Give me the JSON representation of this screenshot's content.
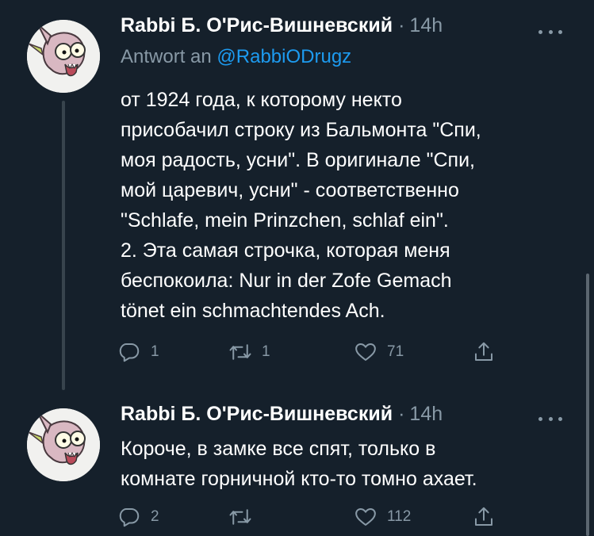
{
  "tweets": [
    {
      "author": "Rabbi Б. О'Рис-Вишневский",
      "separator": "·",
      "time": "14h",
      "reply_prefix": "Antwort an",
      "reply_handle": "@RabbiODrugz",
      "lines": [
        "от 1924 года, к которому некто",
        "присобачил строку из Бальмонта \"Спи,",
        "моя радость, усни\". В оригинале \"Спи,",
        "мой царевич, усни\" - соответственно",
        "\"Schlafe, mein Prinzchen, schlaf ein\".",
        "2. Эта самая строчка, которая меня",
        "беспокоила: Nur in der Zofe Gemach",
        "tönet ein schmachtendes Ach."
      ],
      "replies": "1",
      "retweets": "1",
      "likes": "71"
    },
    {
      "author": "Rabbi Б. О'Рис-Вишневский",
      "separator": "·",
      "time": "14h",
      "lines": [
        "Короче, в замке все спят, только в",
        "комнате горничной кто-то томно ахает."
      ],
      "replies": "2",
      "retweets": "",
      "likes": "112"
    }
  ],
  "icons": {
    "reply": "reply-icon",
    "retweet": "retweet-icon",
    "like": "heart-icon",
    "share": "share-icon",
    "more": "more-icon"
  },
  "colors": {
    "background": "#15202b",
    "secondary_text": "#8899a6",
    "mention": "#1d9bf0",
    "thread_line": "#38444d"
  }
}
